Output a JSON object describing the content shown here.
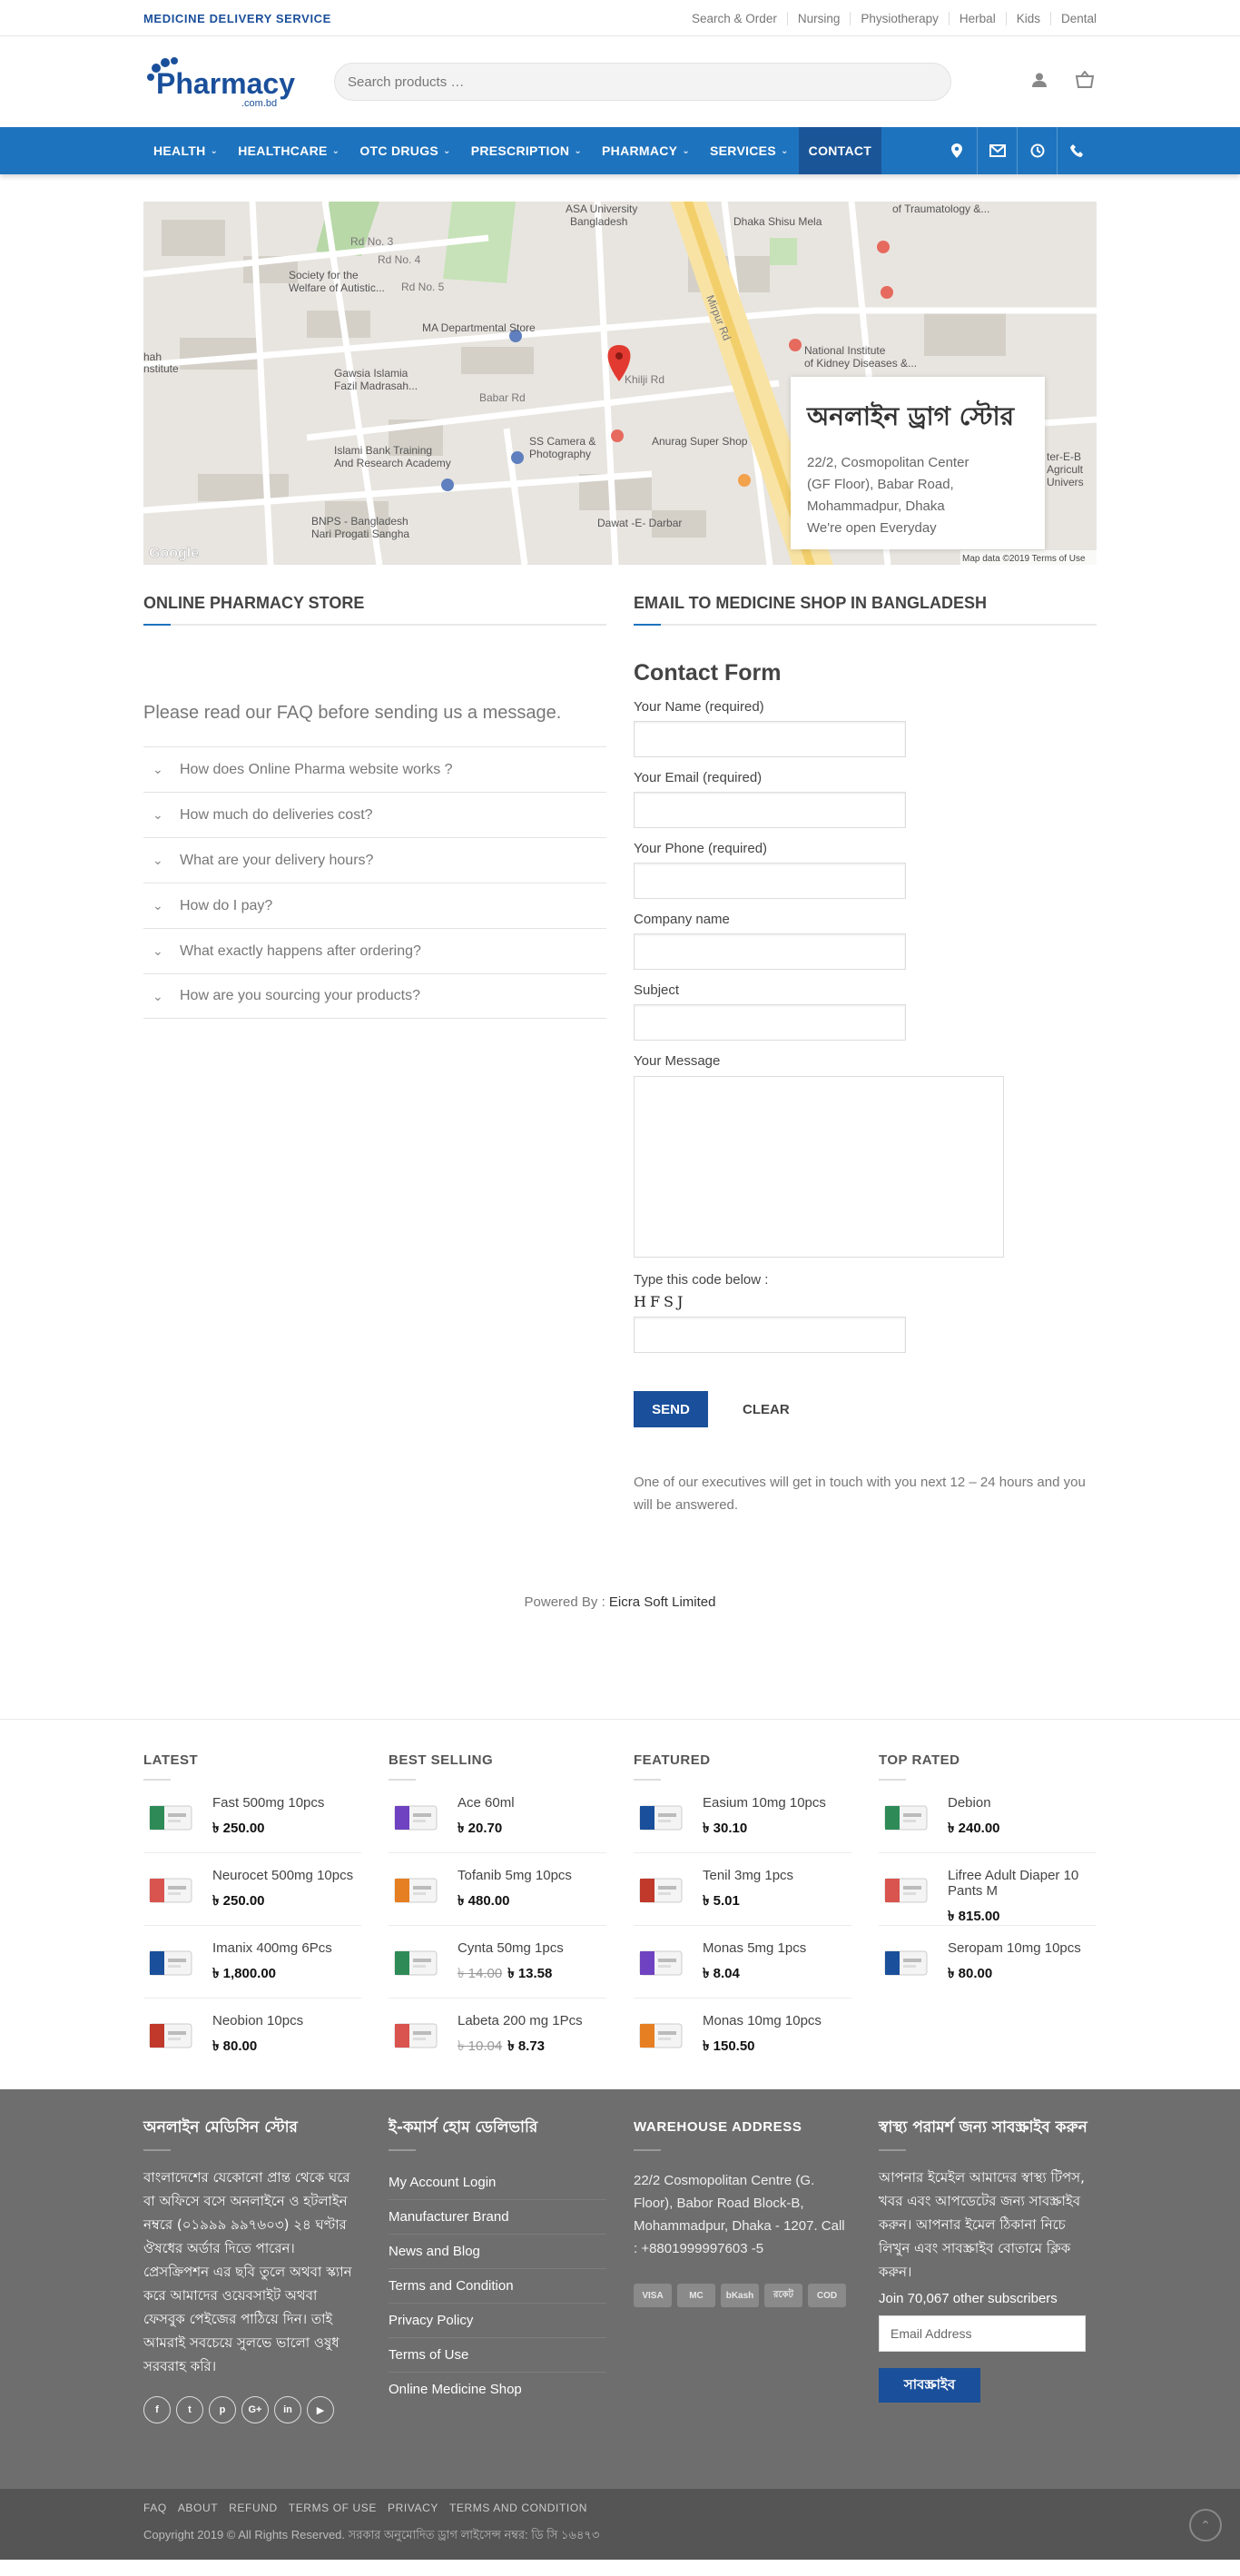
{
  "topbar": {
    "tagline": "MEDICINE DELIVERY SERVICE",
    "links": [
      "Search & Order",
      "Nursing",
      "Physiotherapy",
      "Herbal",
      "Kids",
      "Dental"
    ]
  },
  "header": {
    "logo_text": "Pharmacy",
    "logo_sub": ".com.bd",
    "search_placeholder": "Search products …"
  },
  "nav": {
    "items": [
      {
        "label": "HEALTH",
        "dropdown": true
      },
      {
        "label": "HEALTHCARE",
        "dropdown": true
      },
      {
        "label": "OTC DRUGS",
        "dropdown": true
      },
      {
        "label": "PRESCRIPTION",
        "dropdown": true
      },
      {
        "label": "PHARMACY",
        "dropdown": true
      },
      {
        "label": "SERVICES",
        "dropdown": true
      },
      {
        "label": "CONTACT",
        "dropdown": false
      }
    ],
    "icons": [
      "location-icon",
      "mail-icon",
      "clock-icon",
      "phone-icon"
    ]
  },
  "map": {
    "labels": [
      "ASA University Bangladesh",
      "Dhaka Shisu Mela",
      "of Traumatology &...",
      "Society for the Welfare of Autistic...",
      "MA Departmental Store",
      "Gawsia Islamia Fazil Madrasah...",
      "National Institute of Kidney Diseases &...",
      "SS Camera & Photography",
      "Islami Bank Training And Research Academy",
      "Anurag Super Shop",
      "BNPS - Bangladesh Nari Progati Sangha",
      "Dawat -E- Darbar",
      "Mirpur Rd",
      "Babar Rd",
      "Khilji Rd",
      "Rd No. 3",
      "Rd No. 4",
      "Rd No. 5"
    ],
    "credit_data": "Map data ©2019",
    "credit_terms": "Terms of Use",
    "google": "Google",
    "card_title": "অনলাইন ড্রাগ স্টোর",
    "card_lines": [
      "22/2, Cosmopolitan Center",
      "(GF Floor), Babar Road,",
      "Mohammadpur, Dhaka",
      "We're open Everyday"
    ]
  },
  "left": {
    "title": "ONLINE PHARMACY STORE",
    "intro": "Please read our FAQ before sending us a message.",
    "faqs": [
      "How does Online Pharma website works ?",
      "How much do deliveries cost?",
      "What are your delivery hours?",
      "How do I pay?",
      "What exactly happens after ordering?",
      "How are you sourcing your products?"
    ]
  },
  "right": {
    "title": "EMAIL TO MEDICINE SHOP IN BANGLADESH",
    "form_title": "Contact Form",
    "fields": [
      "Your Name (required)",
      "Your Email (required)",
      "Your Phone (required)",
      "Company name",
      "Subject"
    ],
    "message_label": "Your Message",
    "captcha_label": "Type this code below :",
    "captcha": "HFSJ",
    "send": "SEND",
    "clear": "CLEAR",
    "note": "One of our executives will get in touch with you next 12 – 24 hours and you will be answered."
  },
  "powered": {
    "prefix": "Powered By : ",
    "name": "Eicra Soft Limited"
  },
  "products": [
    {
      "title": "LATEST",
      "items": [
        {
          "name": "Fast 500mg 10pcs",
          "price": "৳ 250.00",
          "old": ""
        },
        {
          "name": "Neurocet 500mg 10pcs",
          "price": "৳ 250.00",
          "old": ""
        },
        {
          "name": "Imanix 400mg 6Pcs",
          "price": "৳ 1,800.00",
          "old": ""
        },
        {
          "name": "Neobion 10pcs",
          "price": "৳ 80.00",
          "old": ""
        }
      ]
    },
    {
      "title": "BEST SELLING",
      "items": [
        {
          "name": "Ace 60ml",
          "price": "৳ 20.70",
          "old": ""
        },
        {
          "name": "Tofanib 5mg 10pcs",
          "price": "৳ 480.00",
          "old": ""
        },
        {
          "name": "Cynta 50mg 1pcs",
          "price": "৳ 13.58",
          "old": "৳ 14.00"
        },
        {
          "name": "Labeta 200 mg 1Pcs",
          "price": "৳ 8.73",
          "old": "৳ 10.04"
        }
      ]
    },
    {
      "title": "FEATURED",
      "items": [
        {
          "name": "Easium 10mg 10pcs",
          "price": "৳ 30.10",
          "old": ""
        },
        {
          "name": "Tenil 3mg 1pcs",
          "price": "৳ 5.01",
          "old": ""
        },
        {
          "name": "Monas 5mg 1pcs",
          "price": "৳ 8.04",
          "old": ""
        },
        {
          "name": "Monas 10mg 10pcs",
          "price": "৳ 150.50",
          "old": ""
        }
      ]
    },
    {
      "title": "TOP RATED",
      "items": [
        {
          "name": "Debion",
          "price": "৳ 240.00",
          "old": ""
        },
        {
          "name": "Lifree Adult Diaper 10 Pants M",
          "price": "৳ 815.00",
          "old": ""
        },
        {
          "name": "Seropam 10mg 10pcs",
          "price": "৳ 80.00",
          "old": ""
        }
      ]
    }
  ],
  "footer": {
    "c1_title": "অনলাইন মেডিসিন স্টোর",
    "c1_text": "বাংলাদেশের যেকোনো প্রান্ত থেকে ঘরে বা অফিসে বসে অনলাইনে ও হটলাইন নম্বরে (০১৯৯৯ ৯৯৭৬০৩) ২৪ ঘণ্টার ঔষধের অর্ডার দিতে পারেন। প্রেসক্রিপশন এর ছবি তুলে অথবা স্ক্যান করে আমাদের ওয়েবসাইট অথবা ফেসবুক পেইজের পাঠিয়ে দিন। তাই আমরাই সবচেয়ে সুলভে ভালো ওষুধ সরবরাহ করি।",
    "social": [
      "f",
      "t",
      "p",
      "G+",
      "in",
      "▶"
    ],
    "c2_title": "ই-কমার্স হোম ডেলিভারি",
    "links": [
      "My Account Login",
      "Manufacturer Brand",
      "News and Blog",
      "Terms and Condition",
      "Privacy Policy",
      "Terms of Use",
      "Online Medicine Shop"
    ],
    "c3_title": "WAREHOUSE ADDRESS",
    "address": "22/2 Cosmopolitan Centre (G. Floor), Babor Road Block-B, Mohammadpur, Dhaka - 1207. Call : +8801999997603 -5",
    "cards": [
      "VISA",
      "MC",
      "bKash",
      "রকেট",
      "COD"
    ],
    "c4_title": "স্বাস্থ্য পরামর্শ জন্য সাবস্ক্রাইব করুন",
    "c4_text": "আপনার ইমেইল আমাদের স্বাস্থ্য টিপস, খবর এবং আপডেটের জন্য সাবস্ক্রাইব করুন। আপনার ইমেল ঠিকানা নিচে লিখুন এবং সাবস্ক্রাইব বোতামে ক্লিক করুন।",
    "subs": "Join 70,067 other subscribers",
    "email_placeholder": "Email Address",
    "subscribe": "সাবস্ক্রাইব"
  },
  "bottom": {
    "links": [
      "FAQ",
      "ABOUT",
      "REFUND",
      "TERMS OF USE",
      "PRIVACY",
      "TERMS AND CONDITION"
    ],
    "copy": "Copyright 2019 © All Rights Reserved.   সরকার অনুমোদিত ড্রাগ লাইসেন্স নম্বর:  ডি সি ১৬৪৭৩"
  },
  "colors": {
    "brand": "#1e73be",
    "dark_brand": "#1a4f9b",
    "footer": "#6e6e6e"
  }
}
